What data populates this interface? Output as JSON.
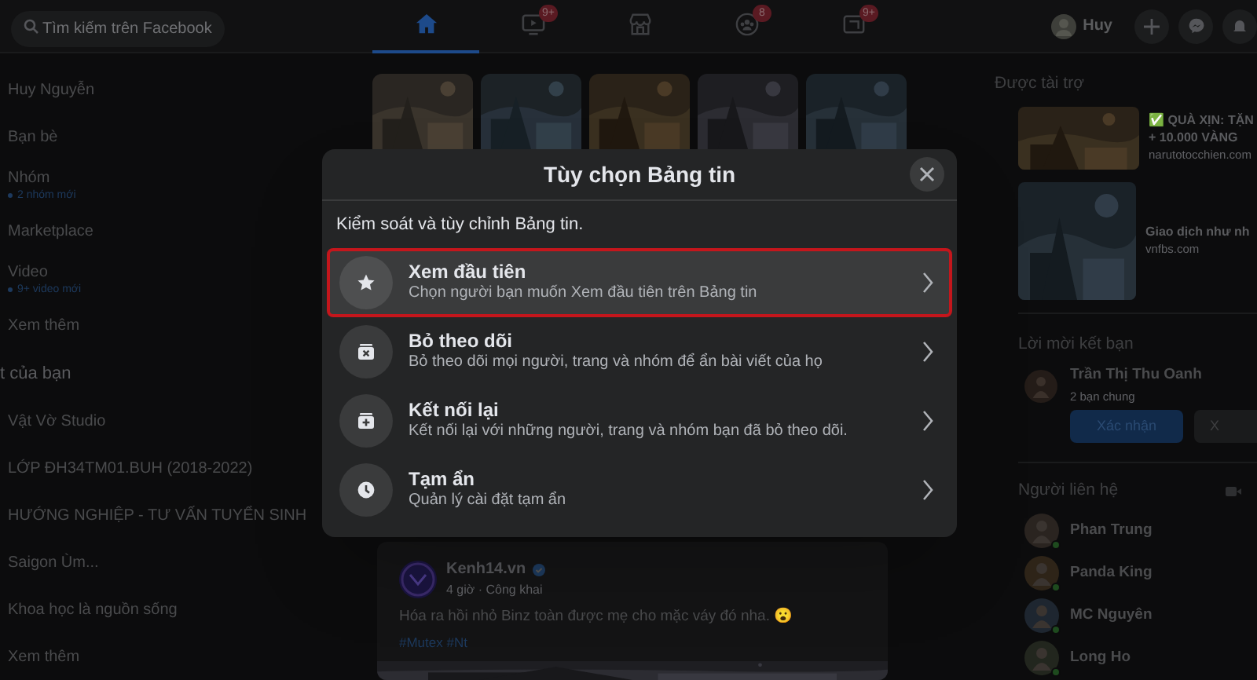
{
  "header": {
    "search": {
      "placeholder": "Tìm kiếm trên Facebook"
    },
    "nav_tabs": [
      {
        "kind": "home",
        "selected": true
      },
      {
        "kind": "video",
        "selected": false,
        "badge": "9+"
      },
      {
        "kind": "marketplace",
        "selected": false
      },
      {
        "kind": "groups",
        "selected": false,
        "badge": "8"
      },
      {
        "kind": "gaming",
        "selected": false,
        "badge": "9+"
      }
    ],
    "profile_name": "Huy"
  },
  "sidebar": {
    "items": [
      {
        "label": "Huy Nguyễn"
      },
      {
        "label": "Bạn bè"
      },
      {
        "label": "Nhóm",
        "sub": "2 nhóm mới"
      },
      {
        "label": "Marketplace"
      },
      {
        "label": "Video",
        "sub": "9+ video mới"
      },
      {
        "label": "Xem thêm"
      }
    ],
    "shortcuts_heading": "t của bạn",
    "shortcuts": [
      "Vật Vờ Studio",
      "LỚP ĐH34TM01.BUH (2018-2022)",
      "HƯỚNG NGHIỆP - TƯ VẤN TUYỂN SINH",
      "Saigon Ùm...",
      "Khoa học là nguồn sống"
    ],
    "shortcuts_more": "Xem thêm"
  },
  "post": {
    "author": "Kenh14.vn",
    "meta": "4 giờ · Công khai",
    "text": "Hóa ra hồi nhỏ Binz toàn được mẹ cho mặc váy đó nha. 😮",
    "hashtags": "#Mutex #Nt"
  },
  "right": {
    "sponsored_heading": "Được tài trợ",
    "ads": [
      {
        "title_lines": [
          "✅ QUÀ XỊN: TẶN",
          "+ 10.000 VÀNG"
        ],
        "domain": "narutotocchien.com"
      },
      {
        "title_lines": [
          "Giao dịch như nh"
        ],
        "domain": "vnfbs.com"
      }
    ],
    "friend_requests_heading": "Lời mời kết bạn",
    "friend_request": {
      "name": "Trần Thị Thu Oanh",
      "mutual": "2 bạn chung",
      "confirm": "Xác nhận",
      "delete": "X"
    },
    "contacts_heading": "Người liên hệ",
    "contacts": [
      {
        "name": "Phan Trung",
        "online": true
      },
      {
        "name": "Panda King",
        "online": true
      },
      {
        "name": "MC Nguyên",
        "online": true
      },
      {
        "name": "Long Ho",
        "online": true
      }
    ]
  },
  "modal": {
    "title": "Tùy chọn Bảng tin",
    "subtitle": "Kiểm soát và tùy chỉnh Bảng tin.",
    "options": [
      {
        "kind": "star",
        "title": "Xem đầu tiên",
        "description": "Chọn người bạn muốn Xem đầu tiên trên Bảng tin",
        "highlighted": true
      },
      {
        "kind": "unfollow",
        "title": "Bỏ theo dõi",
        "description": "Bỏ theo dõi mọi người, trang và nhóm để ẩn bài viết của họ",
        "highlighted": false
      },
      {
        "kind": "reconnect",
        "title": "Kết nối lại",
        "description": "Kết nối lại với những người, trang và nhóm bạn đã bỏ theo dõi.",
        "highlighted": false
      },
      {
        "kind": "snooze",
        "title": "Tạm ẩn",
        "description": "Quản lý cài đặt tạm ẩn",
        "highlighted": false
      }
    ]
  }
}
